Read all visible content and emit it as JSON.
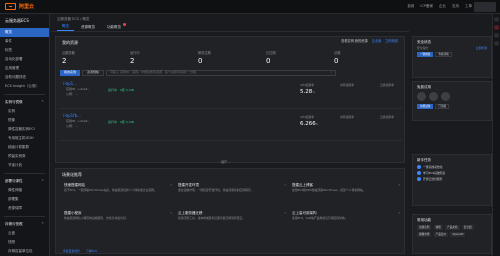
{
  "topbar": {
    "logo_text": "阿里云",
    "links": [
      "费用",
      "ICP备案",
      "企业",
      "支持",
      "工单"
    ]
  },
  "sidebar": {
    "title": "云服务器ECS",
    "items": [
      {
        "label": "概览",
        "active": true
      },
      {
        "label": "事件",
        "active": false
      },
      {
        "label": "标签",
        "active": false
      },
      {
        "label": "自动化部署",
        "active": false
      },
      {
        "label": "应用管理",
        "active": false
      },
      {
        "label": "自助问题排查",
        "active": false
      },
      {
        "label": "ECS Insight（公测）",
        "active": false
      }
    ],
    "groups": [
      {
        "label": "实例与镜像",
        "items": [
          "实例",
          "镜像",
          "弹性容器实例ECI",
          "专用宿主机DDH",
          "超级计算集群",
          "预留实例券",
          "节省计划"
        ]
      },
      {
        "label": "部署与弹性",
        "items": [
          "弹性伸缩",
          "部署集",
          "资源保障"
        ]
      },
      {
        "label": "存储与快照",
        "items": [
          "云盘",
          "快照",
          "存储容量单位包"
        ]
      }
    ]
  },
  "main": {
    "breadcrumb": "云服务器 ECS / 概览",
    "tabs": [
      {
        "label": "概览",
        "active": true,
        "dot": false
      },
      {
        "label": "资源概览",
        "active": false,
        "dot": false
      },
      {
        "label": "功能概览",
        "active": false,
        "dot": true
      }
    ],
    "resources": {
      "title": "我的资源",
      "links": [
        "查看实例 我的资源",
        "企业版",
        "立即续费"
      ],
      "stats": [
        {
          "label": "云服务器",
          "value": "2"
        },
        {
          "label": "运行中",
          "value": "2"
        },
        {
          "label": "即将过期",
          "value": "0"
        },
        {
          "label": "已过期",
          "value": "0"
        },
        {
          "label": "近期",
          "value": "0"
        }
      ],
      "filter_primary": "我的实例",
      "filter_secondary": "资源规格",
      "search_placeholder": "可输入 实例ID、名称、IP地址搜索资源，多个关键词请用“,”分隔"
    },
    "instances": [
      {
        "name": "i-bp1...",
        "id": "实例ID：i-2ze4...",
        "ip": "公网：...",
        "status": "运行中 · 2核 4 GiB",
        "cpu_label": "CPU使用率",
        "cpu_value": "5.28",
        "cpu_unit": "%",
        "mem_label": "内存使用率",
        "mem_value": "",
        "disk_label": "云盘使用率",
        "disk_value": ""
      },
      {
        "name": "i-bp1fb...",
        "id": "实例ID：i-2ze8...",
        "ip": "公网：...",
        "status": "运行中 · 2核 4 GiB",
        "cpu_label": "CPU使用率",
        "cpu_value": "6.266",
        "cpu_unit": "%",
        "mem_label": "内存使用率",
        "mem_value": "",
        "disk_label": "云盘使用率",
        "disk_value": ""
      }
    ],
    "expand_label": "展开 ⌄",
    "quick": {
      "title": "场景化推荐",
      "cards": [
        {
          "title": "快速搭建网站",
          "desc": "基于ECS，一键部署WordPress站点，快速搭建您的个人博客或企业官网。"
        },
        {
          "title": "搭建开发环境",
          "desc": "通过镜像市场，一键搭建开发环境，快速部署您的应用程序。"
        },
        {
          "title": "搭建云上博客",
          "desc": "使用ECS和RDS快速部署WordPress，搭建个人博客网站。"
        },
        {
          "title": "搭建小程序",
          "desc": "快速搭建微信小程序的后端服务，支持高并发访问。"
        },
        {
          "title": "云上服务器迁移",
          "desc": "使用迁移工具，将本地或其他云服务器迁移到阿里云。"
        },
        {
          "title": "云上高可用架构",
          "desc": "使用ECS、SLB等产品构建高可用应用架构。"
        }
      ],
      "footer_links": [
        "查看更多场景",
        "了解ECS"
      ]
    }
  },
  "right": {
    "security": {
      "title": "安全状态",
      "lines": [
        "安全得分",
        "立即检测"
      ],
      "buttons": [
        "一键修复",
        "查看详情"
      ]
    },
    "free": {
      "title": "免费试用",
      "value": "0",
      "buttons": [
        "免费试用",
        "已领取"
      ]
    },
    "news": {
      "title": "新手任务",
      "items": [
        "一键完成初始化",
        "学习ECS基础知识",
        "开通云监控服务"
      ]
    },
    "help": {
      "title": "常用功能",
      "tags": [
        "创建实例",
        "快照",
        "产品文档",
        "安全组",
        "镜像市场",
        "产品定价",
        "OpenAPI"
      ]
    }
  },
  "colors": {
    "accent": "#2b66c4",
    "link": "#3a86ff",
    "brand": "#ff6a00",
    "ok": "#3dc98a"
  }
}
